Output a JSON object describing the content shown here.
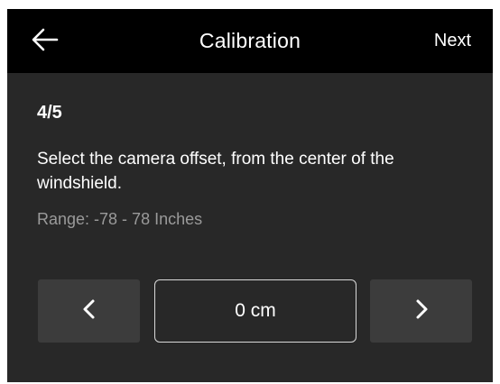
{
  "header": {
    "title": "Calibration",
    "next_label": "Next",
    "back_icon": "arrow-left-icon"
  },
  "content": {
    "step": "4/5",
    "instruction": "Select the camera offset, from the center of the windshield.",
    "range": "Range: -78 - 78 Inches"
  },
  "stepper": {
    "value": "0 cm",
    "decrement_icon": "chevron-left-icon",
    "increment_icon": "chevron-right-icon"
  },
  "colors": {
    "header_bg": "#000000",
    "screen_bg": "#282828",
    "button_bg": "#3c3c3c",
    "text": "#ffffff",
    "muted_text": "#9a9a9a"
  }
}
